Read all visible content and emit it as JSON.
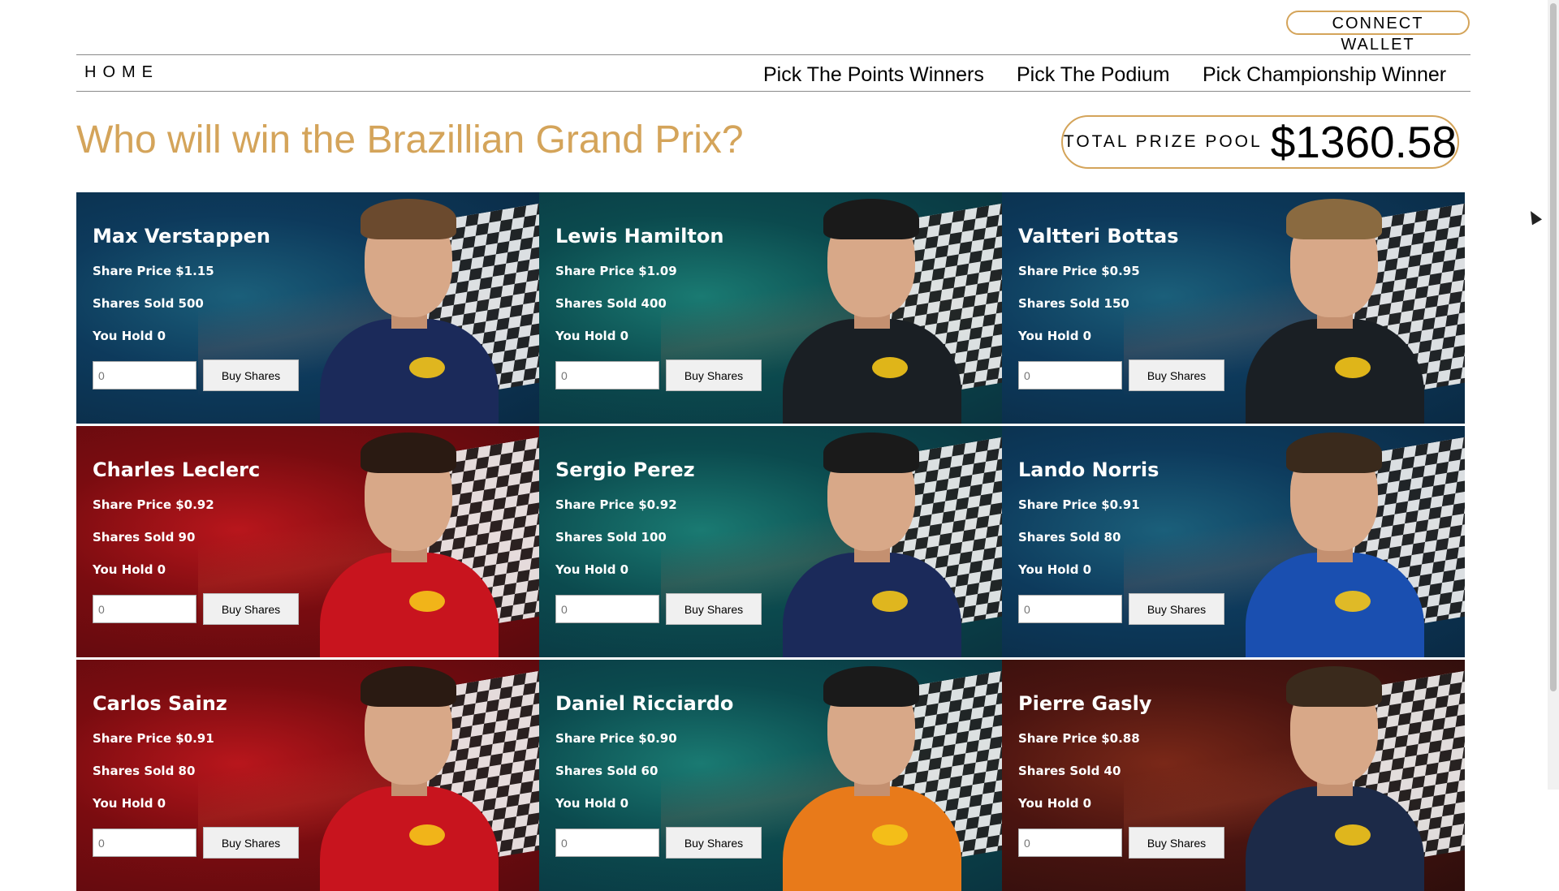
{
  "header": {
    "connect_wallet": "CONNECT WALLET",
    "nav": {
      "home": "HOME",
      "links": [
        "Pick The Points Winners",
        "Pick The Podium",
        "Pick Championship Winner"
      ]
    }
  },
  "main": {
    "title": "Who will win the Brazillian Grand Prix?",
    "prize_pool_label": "TOTAL PRIZE POOL",
    "prize_pool_value": "$1360.58",
    "accent_color": "#d4a45a"
  },
  "drivers": [
    {
      "name": "Max Verstappen",
      "price": "Share Price $1.15",
      "sold": "Shares Sold 500",
      "hold": "You Hold 0",
      "theme": "blue",
      "suit": "#1b2a5a",
      "hair": "#6b4a2e"
    },
    {
      "name": "Lewis Hamilton",
      "price": "Share Price $1.09",
      "sold": "Shares Sold 400",
      "hold": "You Hold 0",
      "theme": "teal",
      "suit": "#1a1f24",
      "hair": "#1a1a1a"
    },
    {
      "name": "Valtteri Bottas",
      "price": "Share Price $0.95",
      "sold": "Shares Sold 150",
      "hold": "You Hold 0",
      "theme": "blue",
      "suit": "#1a1f24",
      "hair": "#8a6a40"
    },
    {
      "name": "Charles Leclerc",
      "price": "Share Price $0.92",
      "sold": "Shares Sold 90",
      "hold": "You Hold 0",
      "theme": "red",
      "suit": "#c8141e",
      "hair": "#2a1a12"
    },
    {
      "name": "Sergio Perez",
      "price": "Share Price $0.92",
      "sold": "Shares Sold 100",
      "hold": "You Hold 0",
      "theme": "teal",
      "suit": "#1b2a5a",
      "hair": "#1a1a1a"
    },
    {
      "name": "Lando Norris",
      "price": "Share Price $0.91",
      "sold": "Shares Sold 80",
      "hold": "You Hold 0",
      "theme": "blue",
      "suit": "#1a4fb0",
      "hair": "#3a2a1c"
    },
    {
      "name": "Carlos Sainz",
      "price": "Share Price $0.91",
      "sold": "Shares Sold 80",
      "hold": "You Hold 0",
      "theme": "red",
      "suit": "#c8141e",
      "hair": "#2a1a12"
    },
    {
      "name": "Daniel Ricciardo",
      "price": "Share Price $0.90",
      "sold": "Shares Sold 60",
      "hold": "You Hold 0",
      "theme": "teal",
      "suit": "#e87a1a",
      "hair": "#1a1a1a"
    },
    {
      "name": "Pierre Gasly",
      "price": "Share Price $0.88",
      "sold": "Shares Sold 40",
      "hold": "You Hold 0",
      "theme": "darkred",
      "suit": "#1c2a48",
      "hair": "#3a2a1c"
    }
  ],
  "buy": {
    "input_placeholder": "0",
    "button_label": "Buy Shares"
  },
  "themes": {
    "blue": [
      "#0d3a5c",
      "#1b5f7a",
      "#0a2a44"
    ],
    "teal": [
      "#0b4a4e",
      "#1a7a72",
      "#0a3440"
    ],
    "red": [
      "#7a0c10",
      "#b8161c",
      "#5a0a0e"
    ],
    "darkred": [
      "#4a1410",
      "#7a2818",
      "#2e0e0c"
    ]
  }
}
